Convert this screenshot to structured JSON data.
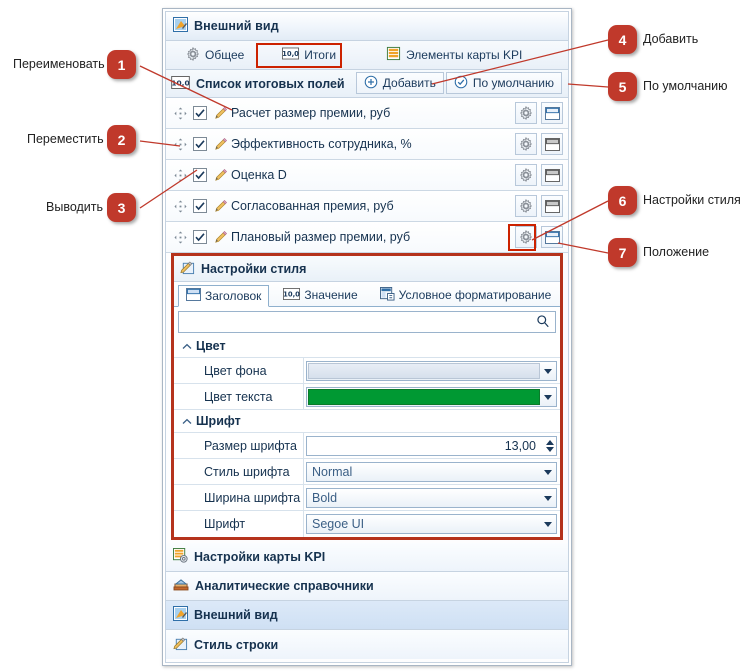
{
  "window": {
    "header": {
      "title": "Внешний вид",
      "icon": "appearance-icon"
    },
    "tabs": [
      {
        "label": "Общее",
        "icon": "gear-icon",
        "selected": false
      },
      {
        "label": "Итоги",
        "icon": "totals-10-icon",
        "selected": true,
        "highlighted": true
      },
      {
        "label": "Элементы карты KPI",
        "icon": "kpi-grid-icon",
        "selected": false
      }
    ],
    "subheader": {
      "title": "Список итоговых полей",
      "icon": "totals-10-icon",
      "buttons": [
        {
          "label": "Добавить",
          "icon": "plus-circle-icon"
        },
        {
          "label": "По умолчанию",
          "icon": "check-circle-icon"
        }
      ]
    },
    "rows": [
      {
        "label": "Расчет размер премии, руб",
        "checked": true,
        "position_icon": "position-top-blue-icon"
      },
      {
        "label": "Эффективность сотрудника, %",
        "checked": true,
        "position_icon": "position-top-gray-icon"
      },
      {
        "label": "Оценка D",
        "checked": true,
        "position_icon": "position-top-gray-icon"
      },
      {
        "label": "Согласованная премия, руб",
        "checked": true,
        "position_icon": "position-top-gray-icon"
      },
      {
        "label": "Плановый размер премии, руб",
        "checked": true,
        "position_icon": "position-top-blue-icon"
      }
    ],
    "style_panel": {
      "title": "Настройки стиля",
      "icon": "style-settings-icon",
      "tabs": [
        {
          "label": "Заголовок",
          "icon": "header-block-icon",
          "selected": true
        },
        {
          "label": "Значение",
          "icon": "totals-10-icon",
          "selected": false
        },
        {
          "label": "Условное форматирование",
          "icon": "conditional-format-icon",
          "selected": false
        }
      ],
      "search": {
        "value": "",
        "placeholder": "",
        "icon": "search-icon"
      },
      "groups": [
        {
          "name": "Цвет",
          "properties": [
            {
              "name": "Цвет фона",
              "type": "color",
              "value": "",
              "color": "#dce6f1"
            },
            {
              "name": "Цвет текста",
              "type": "color",
              "value": "",
              "color": "#009933"
            }
          ]
        },
        {
          "name": "Шрифт",
          "properties": [
            {
              "name": "Размер шрифта",
              "type": "spin",
              "value": "13,00"
            },
            {
              "name": "Стиль шрифта",
              "type": "combo",
              "value": "Normal"
            },
            {
              "name": "Ширина шрифта",
              "type": "combo",
              "value": "Bold"
            },
            {
              "name": "Шрифт",
              "type": "combo",
              "value": "Segoe UI"
            }
          ]
        }
      ]
    },
    "accordion": [
      {
        "label": "Настройки карты KPI",
        "icon": "kpi-settings-icon",
        "active": false
      },
      {
        "label": "Аналитические справочники",
        "icon": "books-icon",
        "active": false
      },
      {
        "label": "Внешний вид",
        "icon": "appearance-icon",
        "active": true
      },
      {
        "label": "Стиль строки",
        "icon": "style-settings-icon",
        "active": false
      }
    ]
  },
  "annotations": {
    "accent_color": "#c0392b",
    "items": [
      {
        "number": "1",
        "label": "Переименовать",
        "side": "left"
      },
      {
        "number": "2",
        "label": "Переместить",
        "side": "left"
      },
      {
        "number": "3",
        "label": "Выводить",
        "side": "left"
      },
      {
        "number": "4",
        "label": "Добавить",
        "side": "right"
      },
      {
        "number": "5",
        "label": "По умолчанию",
        "side": "right"
      },
      {
        "number": "6",
        "label": "Настройки стиля",
        "side": "right"
      },
      {
        "number": "7",
        "label": "Положение",
        "side": "right"
      }
    ]
  }
}
